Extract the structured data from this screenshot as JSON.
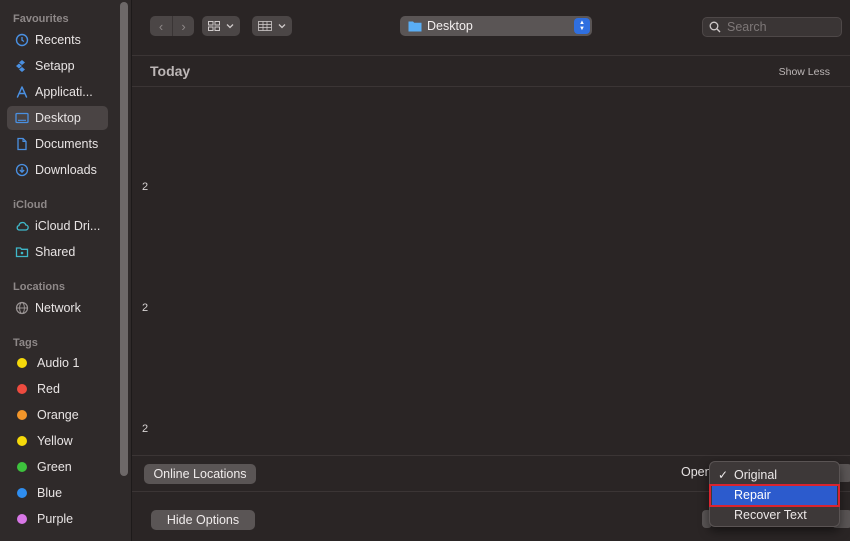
{
  "sidebar": {
    "sections": {
      "favourites": "Favourites",
      "icloud": "iCloud",
      "locations": "Locations",
      "tags": "Tags"
    },
    "favourites": [
      {
        "label": "Recents",
        "icon": "clock-icon"
      },
      {
        "label": "Setapp",
        "icon": "setapp-icon"
      },
      {
        "label": "Applicati...",
        "icon": "applications-icon"
      },
      {
        "label": "Desktop",
        "icon": "desktop-icon",
        "active": true
      },
      {
        "label": "Documents",
        "icon": "document-icon"
      },
      {
        "label": "Downloads",
        "icon": "download-icon"
      }
    ],
    "icloud": [
      {
        "label": "iCloud Dri...",
        "icon": "cloud-icon"
      },
      {
        "label": "Shared",
        "icon": "shared-folder-icon"
      }
    ],
    "locations": [
      {
        "label": "Network",
        "icon": "globe-icon"
      }
    ],
    "tags": [
      {
        "label": "Audio 1",
        "color": "#f5d90a"
      },
      {
        "label": "Red",
        "color": "#ee4b3f"
      },
      {
        "label": "Orange",
        "color": "#f3962a"
      },
      {
        "label": "Yellow",
        "color": "#f5d90a"
      },
      {
        "label": "Green",
        "color": "#3dc23d"
      },
      {
        "label": "Blue",
        "color": "#2f8ef0"
      },
      {
        "label": "Purple",
        "color": "#d877e6"
      }
    ]
  },
  "toolbar": {
    "back_icon": "chevron-left-icon",
    "forward_icon": "chevron-right-icon",
    "path_label": "Desktop",
    "search_placeholder": "Search"
  },
  "content": {
    "section_title": "Today",
    "show_less": "Show Less",
    "fragments": [
      "2",
      "2",
      "2"
    ]
  },
  "bottom": {
    "online_locations": "Online Locations",
    "open_label": "Open",
    "hide_options": "Hide Options"
  },
  "menu": {
    "items": [
      {
        "label": "Original",
        "checked": true
      },
      {
        "label": "Repair",
        "highlighted": true
      },
      {
        "label": "Recover Text"
      }
    ],
    "highlight_color": "#2c5bcd",
    "annotation_color": "#d9242f"
  }
}
